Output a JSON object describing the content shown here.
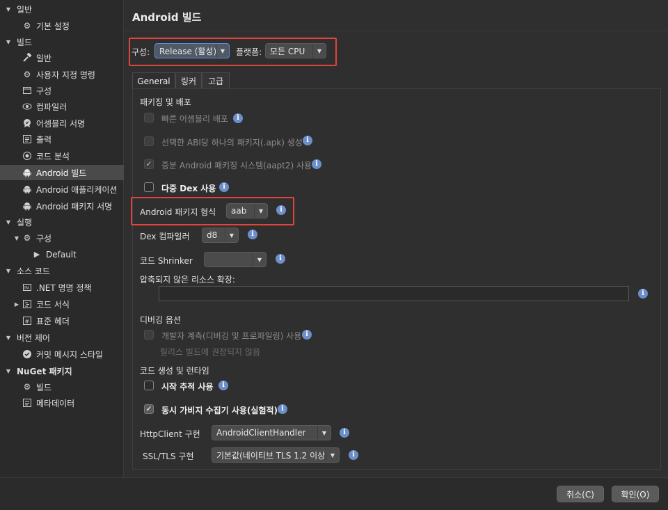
{
  "sidebar": {
    "items": [
      {
        "label": "일반",
        "icon": "none"
      },
      {
        "label": "기본 설정",
        "icon": "gear-icon"
      },
      {
        "label": "빌드",
        "icon": "none"
      },
      {
        "label": "일반",
        "icon": "hammer-icon"
      },
      {
        "label": "사용자 지정 명령",
        "icon": "gear-icon"
      },
      {
        "label": "구성",
        "icon": "window-icon"
      },
      {
        "label": "컴파일러",
        "icon": "eye-icon"
      },
      {
        "label": "어셈블리 서명",
        "icon": "badge-icon"
      },
      {
        "label": "출력",
        "icon": "list-icon"
      },
      {
        "label": "코드 분석",
        "icon": "target-icon"
      },
      {
        "label": "Android 빌드",
        "icon": "android-icon"
      },
      {
        "label": "Android 애플리케이션",
        "icon": "android-icon"
      },
      {
        "label": "Android 패키지 서명",
        "icon": "android-icon"
      },
      {
        "label": "실행",
        "icon": "none"
      },
      {
        "label": "구성",
        "icon": "gear-icon"
      },
      {
        "label": "Default",
        "icon": "play-icon"
      },
      {
        "label": "소스 코드",
        "icon": "none"
      },
      {
        "label": ".NET 명명 정책",
        "icon": "naming-icon"
      },
      {
        "label": "코드 서식",
        "icon": "code-format-icon"
      },
      {
        "label": "표준 헤더",
        "icon": "hash-icon"
      },
      {
        "label": "버전 제어",
        "icon": "none"
      },
      {
        "label": "커밋 메시지 스타일",
        "icon": "check-circle-icon"
      },
      {
        "label": "NuGet 패키지",
        "icon": "none"
      },
      {
        "label": "빌드",
        "icon": "gear-icon"
      },
      {
        "label": "메타데이터",
        "icon": "list-icon"
      }
    ]
  },
  "header": {
    "title": "Android 빌드"
  },
  "config": {
    "config_label": "구성:",
    "config_value": "Release (활성)",
    "platform_label": "플랫폼:",
    "platform_value": "모든 CPU"
  },
  "tabs": [
    {
      "label": "General"
    },
    {
      "label": "링커"
    },
    {
      "label": "고급"
    }
  ],
  "packaging": {
    "heading": "패키징 및 배포",
    "fast_deploy": "빠른 어셈블리 배포",
    "abi_apk": "선택한 ABI당 하나의 패키지(.apk) 생성",
    "aapt2": "증분 Android 패키징 시스템(aapt2) 사용",
    "multidex": "다중 Dex 사용",
    "package_format_label": "Android 패키지 형식",
    "package_format_value": "aab",
    "dex_compiler_label": "Dex 컴파일러",
    "dex_compiler_value": "d8",
    "shrinker_label": "코드 Shrinker",
    "shrinker_value": "",
    "uncompressed_label": "압축되지 않은 리소스 확장:",
    "uncompressed_value": ""
  },
  "debug": {
    "heading": "디버깅 옵션",
    "dev_instrumentation": "개발자 계측(디버깅 및 프로파일링) 사용",
    "note": "릴리스 빌드에 권장되지 않음"
  },
  "codegen": {
    "heading": "코드 생성 및 런타임",
    "startup_tracing": "시작 추적 사용",
    "concurrent_gc": "동시 가비지 수집기 사용(실험적)",
    "httpclient_label": "HttpClient 구현",
    "httpclient_value": "AndroidClientHandler",
    "ssl_label": "SSL/TLS 구현",
    "ssl_value": "기본값(네이티브 TLS 1.2 이상)"
  },
  "footer": {
    "cancel": "취소(C)",
    "ok": "확인(O)"
  },
  "colors": {
    "highlight": "#e0443a",
    "info": "#6d8fc9",
    "selected_row": "#4a4a4a"
  }
}
